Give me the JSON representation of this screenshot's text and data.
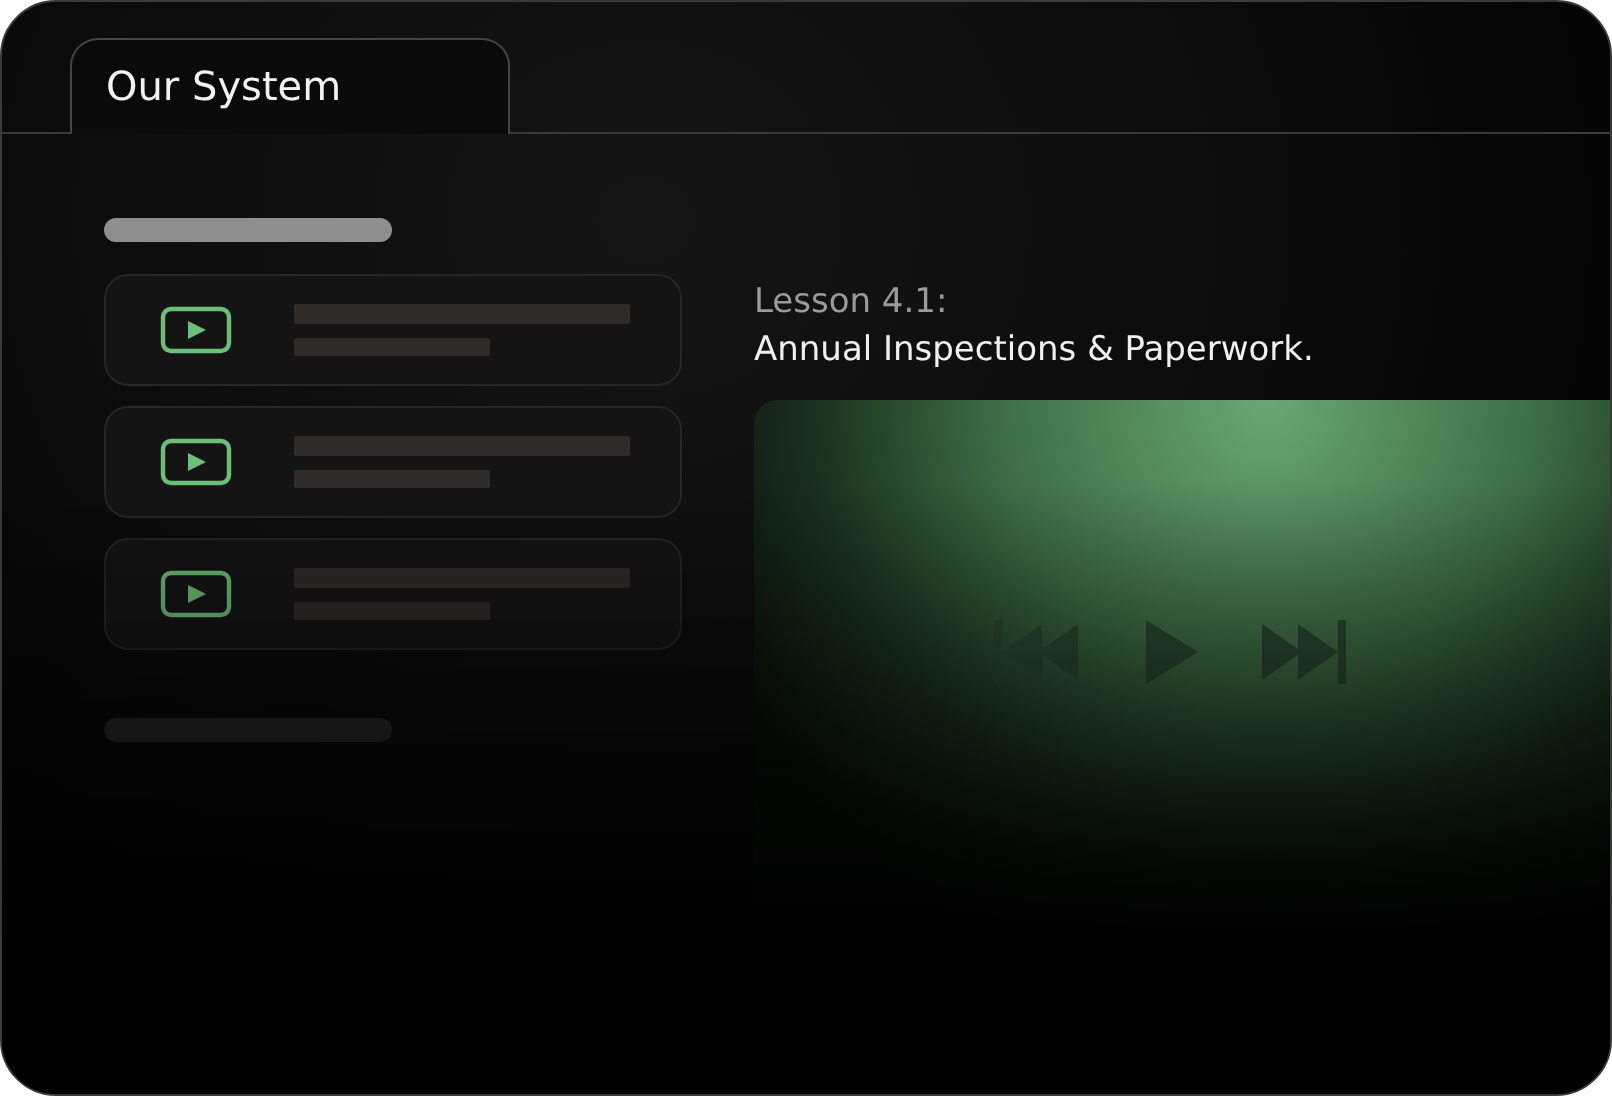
{
  "tabs": [
    {
      "label": "Our System",
      "selected": true
    }
  ],
  "lessons": [
    {
      "kind": "video"
    },
    {
      "kind": "video"
    },
    {
      "kind": "video"
    }
  ],
  "lesson": {
    "number": "Lesson 4.1:",
    "title": "Annual Inspections & Paperwork."
  }
}
